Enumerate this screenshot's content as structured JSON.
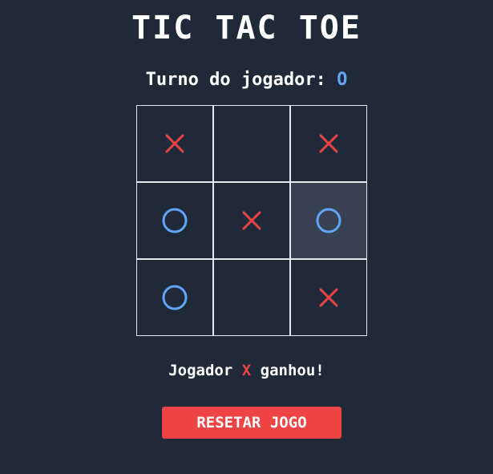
{
  "title": "TIC TAC TOE",
  "turn": {
    "label": "Turno do jogador:",
    "player": "O"
  },
  "board": {
    "cells": [
      "X",
      "",
      "X",
      "O",
      "X",
      "O",
      "O",
      "",
      "X"
    ],
    "highlighted_index": 5
  },
  "status": {
    "prefix": "Jogador",
    "winner": "X",
    "suffix": "ganhou!"
  },
  "reset_label": "RESETAR JOGO",
  "colors": {
    "background": "#1f2937",
    "x_mark": "#ef4444",
    "o_mark": "#60a5fa",
    "cell_highlight": "#374151",
    "grid_line": "#e5e7eb",
    "reset_button": "#ef4444"
  }
}
